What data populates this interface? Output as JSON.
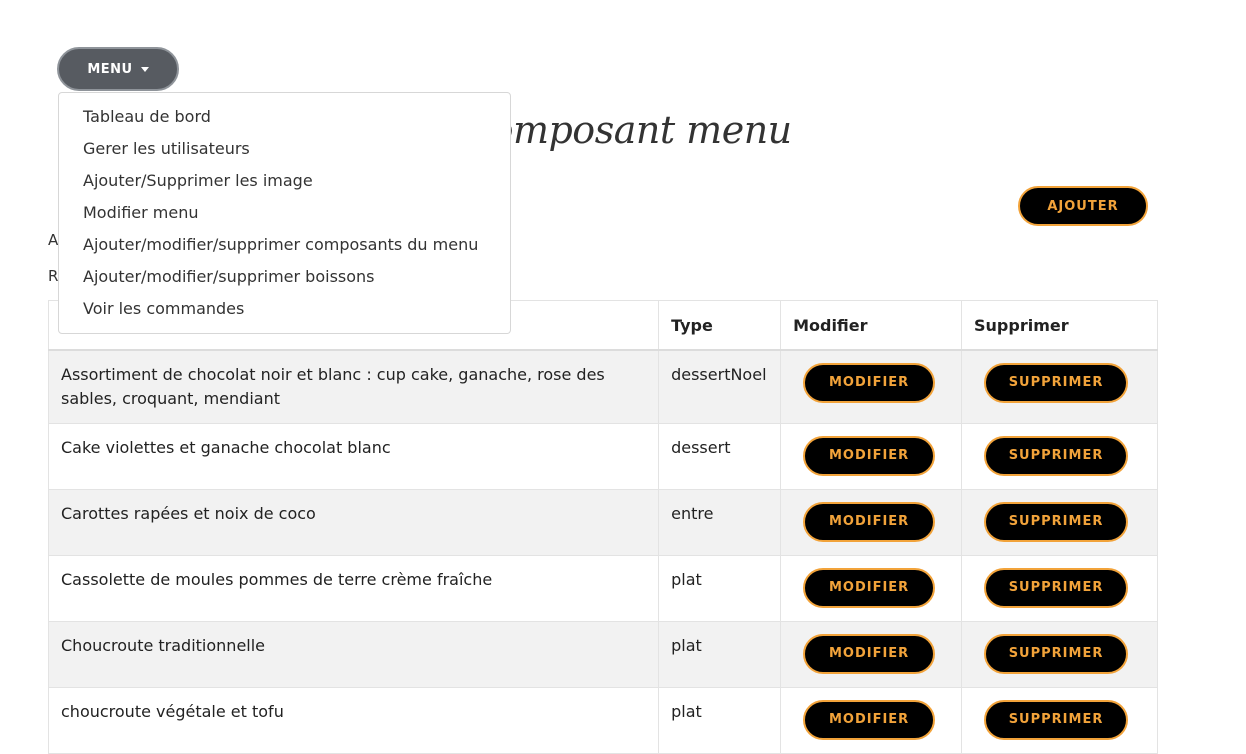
{
  "menu": {
    "button_label": "MENU",
    "items": [
      "Tableau de bord",
      "Gerer les utilisateurs",
      "Ajouter/Supprimer les image",
      "Modifier menu",
      "Ajouter/modifier/supprimer composants du menu",
      "Ajouter/modifier/supprimer boissons",
      "Voir les commandes"
    ]
  },
  "page": {
    "title": "Composant menu",
    "add_label": "AJOUTER",
    "left_fragment_1": "A",
    "left_fragment_2": "Re"
  },
  "table": {
    "headers": {
      "name": "",
      "type": "Type",
      "modify": "Modifier",
      "delete": "Supprimer"
    },
    "modify_label": "MODIFIER",
    "delete_label": "SUPPRIMER",
    "rows": [
      {
        "name": "Assortiment de chocolat noir et blanc : cup cake, ganache, rose des sables, croquant, mendiant",
        "type": "dessertNoel"
      },
      {
        "name": "Cake violettes et ganache chocolat blanc",
        "type": "dessert"
      },
      {
        "name": "Carottes rapées et noix de coco",
        "type": "entre"
      },
      {
        "name": "Cassolette de moules pommes de terre crème fraîche",
        "type": "plat"
      },
      {
        "name": "Choucroute traditionnelle",
        "type": "plat"
      },
      {
        "name": "choucroute végétale et tofu",
        "type": "plat"
      }
    ]
  },
  "colors": {
    "accent": "#f2a33a",
    "button_bg": "#000000",
    "menu_bg": "#575b61"
  }
}
